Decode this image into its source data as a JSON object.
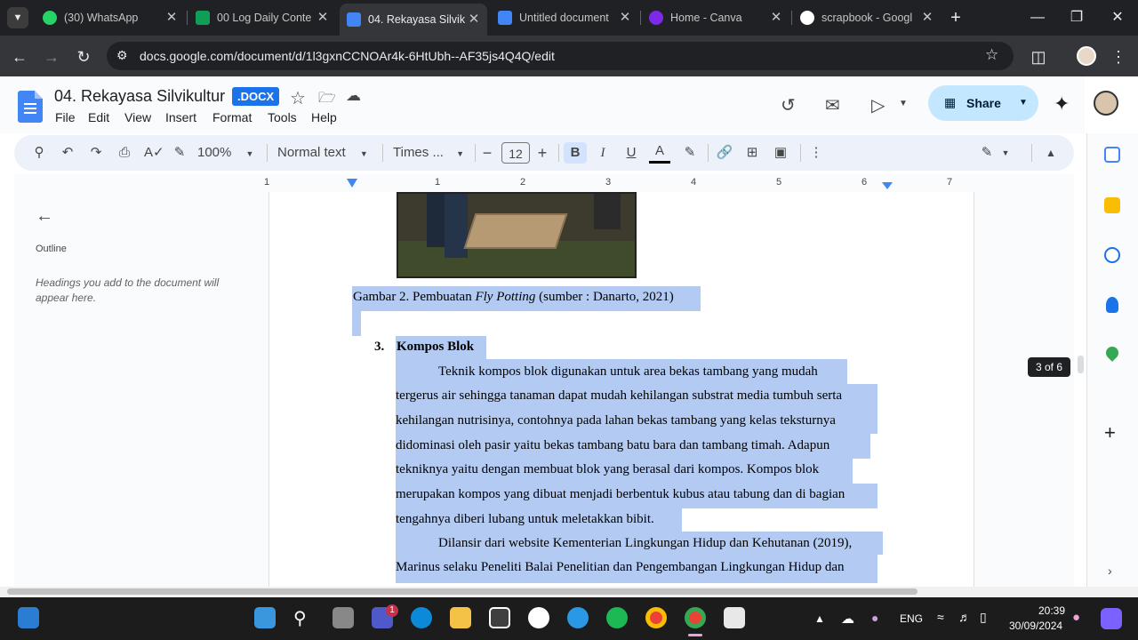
{
  "browser": {
    "tabs": [
      {
        "title": "(30) WhatsApp",
        "color": "#25d366"
      },
      {
        "title": "00 Log Daily Conte",
        "color": "#0f9d58"
      },
      {
        "title": "04. Rekayasa Silvik",
        "color": "#4285f4",
        "active": true
      },
      {
        "title": "Untitled document",
        "color": "#4285f4"
      },
      {
        "title": "Home - Canva",
        "color": "#7d2ae8"
      },
      {
        "title": "scrapbook - Googl",
        "color": "#ffffff"
      }
    ],
    "url": "docs.google.com/document/d/1l3gxnCCNOAr4k-6HtUbh--AF35js4Q4Q/edit"
  },
  "doc": {
    "title": "04. Rekayasa Silvikultur",
    "badge": ".DOCX",
    "menu": [
      "File",
      "Edit",
      "View",
      "Insert",
      "Format",
      "Tools",
      "Help"
    ],
    "share_label": "Share"
  },
  "toolbar": {
    "zoom": "100%",
    "style": "Normal text",
    "font": "Times ...",
    "font_size": "12"
  },
  "ruler": [
    "1",
    "1",
    "2",
    "3",
    "4",
    "5",
    "6",
    "7"
  ],
  "outline": {
    "title": "Outline",
    "hint": "Headings you add to the document will appear here."
  },
  "content": {
    "caption_prefix": "Gambar 2. Pembuatan ",
    "caption_italic": "Fly Potting",
    "caption_suffix": " (sumber : Danarto, 2021)",
    "heading_num": "3.",
    "heading": "Kompos Blok",
    "para1": [
      "Teknik kompos blok digunakan untuk area bekas tambang yang mudah",
      "tergerus air sehingga tanaman dapat mudah kehilangan substrat media tumbuh serta",
      "kehilangan nutrisinya, contohnya pada lahan bekas tambang yang kelas teksturnya",
      "didominasi oleh pasir yaitu bekas tambang batu bara dan tambang timah. Adapun",
      "tekniknya yaitu dengan membuat blok yang berasal dari kompos. Kompos blok",
      "merupakan kompos yang dibuat menjadi berbentuk kubus atau tabung dan di bagian",
      "tengahnya diberi lubang untuk meletakkan bibit."
    ],
    "para2": [
      "Dilansir dari website Kementerian Lingkungan Hidup dan Kehutanan (2019),",
      "Marinus selaku Peneliti Balai Penelitian dan Pengembangan Lingkungan Hidup dan"
    ]
  },
  "page_indicator": "3 of 6",
  "taskbar": {
    "teams_badge": "1",
    "lang": "ENG",
    "time": "20:39",
    "date": "30/09/2024"
  }
}
